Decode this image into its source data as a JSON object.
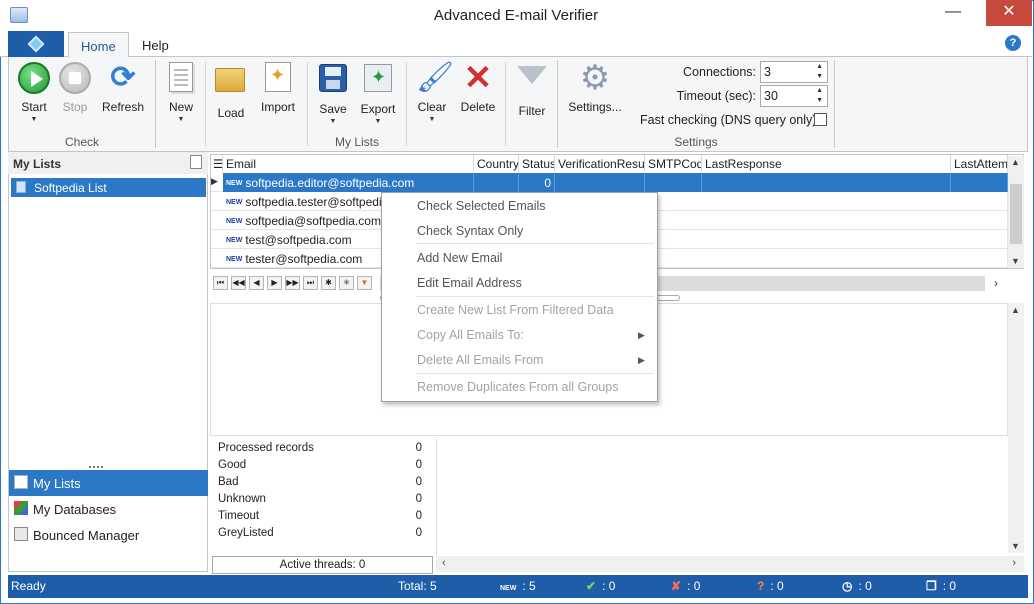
{
  "window": {
    "title": "Advanced E-mail Verifier",
    "minimize": "—",
    "close": "✕"
  },
  "ribbon": {
    "tabs": [
      {
        "label": "Home"
      },
      {
        "label": "Help"
      }
    ],
    "help_icon": "?",
    "groups": {
      "check": {
        "label": "Check",
        "buttons": [
          {
            "label": "Start"
          },
          {
            "label": "Stop"
          },
          {
            "label": "Refresh"
          }
        ]
      },
      "mylists": {
        "label": "My Lists",
        "buttons": [
          {
            "label": "New"
          },
          {
            "label": "Load"
          },
          {
            "label": "Import"
          },
          {
            "label": "Save"
          },
          {
            "label": "Export"
          },
          {
            "label": "Clear"
          },
          {
            "label": "Delete"
          },
          {
            "label": "Filter"
          }
        ]
      },
      "settings": {
        "label": "Settings",
        "settings_button": "Settings...",
        "connections_label": "Connections:",
        "connections_value": "3",
        "timeout_label": "Timeout (sec):",
        "timeout_value": "30",
        "fast_checking_label": "Fast checking (DNS query only)",
        "fast_checking_checked": false
      }
    }
  },
  "left_panel": {
    "header": "My Lists",
    "lists": [
      {
        "label": "Softpedia List",
        "selected": true
      }
    ],
    "nav": [
      {
        "label": "My Lists",
        "icon": "list-icon",
        "selected": true
      },
      {
        "label": "My Databases",
        "icon": "database-icon"
      },
      {
        "label": "Bounced Manager",
        "icon": "bounced-icon"
      }
    ]
  },
  "grid": {
    "columns": [
      "Email",
      "Country",
      "Status",
      "VerificationResult",
      "SMTPCode",
      "LastResponse",
      "LastAttemp"
    ],
    "rows": [
      {
        "tag": "NEW",
        "email": "softpedia.editor@softpedia.com",
        "country": "",
        "status": "0",
        "selected": true
      },
      {
        "tag": "NEW",
        "email": "softpedia.tester@softpedia.",
        "country": "",
        "status": ""
      },
      {
        "tag": "NEW",
        "email": "softpedia@softpedia.com",
        "country": "",
        "status": ""
      },
      {
        "tag": "NEW",
        "email": "test@softpedia.com",
        "country": "",
        "status": ""
      },
      {
        "tag": "NEW",
        "email": "tester@softpedia.com",
        "country": "",
        "status": ""
      }
    ],
    "navigator": [
      "⏮",
      "◀◀",
      "◀",
      "▶",
      "▶▶",
      "⏭",
      "✱",
      "✳",
      "▼"
    ]
  },
  "context_menu": {
    "items": [
      {
        "label": "Check Selected Emails",
        "enabled": true
      },
      {
        "label": "Check Syntax Only",
        "enabled": true
      },
      {
        "label": "Add New Email",
        "enabled": true
      },
      {
        "label": "Edit Email Address",
        "enabled": true
      },
      {
        "label": "Create New List From Filtered Data",
        "enabled": false
      },
      {
        "label": "Copy All Emails To:",
        "enabled": false,
        "submenu": true
      },
      {
        "label": "Delete All Emails From",
        "enabled": false,
        "submenu": true
      },
      {
        "label": "Remove Duplicates From all Groups",
        "enabled": false
      }
    ]
  },
  "stats": {
    "rows": [
      {
        "label": "Processed records",
        "value": "0"
      },
      {
        "label": "Good",
        "value": "0"
      },
      {
        "label": "Bad",
        "value": "0"
      },
      {
        "label": "Unknown",
        "value": "0"
      },
      {
        "label": "Timeout",
        "value": "0"
      },
      {
        "label": "GreyListed",
        "value": "0"
      }
    ],
    "active_threads": "Active threads: 0"
  },
  "statusbar": {
    "state": "Ready",
    "total": "Total: 5",
    "new_tag": "NEW",
    "new_count": ": 5",
    "good_count": ": 0",
    "bad_count": ": 0",
    "unknown_count": ": 0",
    "timeout_count": ": 0",
    "other_count": ": 0"
  },
  "colors": {
    "accent": "#2b78c6",
    "statusbar": "#1e5ea8",
    "close": "#c74a3f"
  }
}
